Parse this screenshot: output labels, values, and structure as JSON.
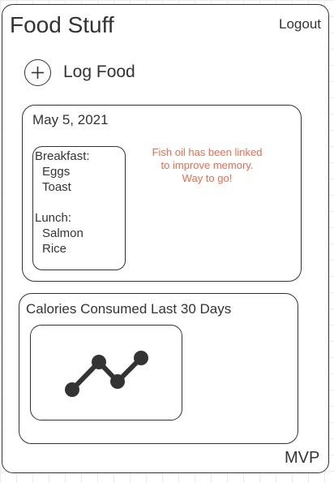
{
  "header": {
    "app_title": "Food Stuff",
    "logout_label": "Logout"
  },
  "actions": {
    "log_food_label": "Log Food",
    "log_food_icon": "plus-icon"
  },
  "day_card": {
    "date": "May 5, 2021",
    "meals": [
      {
        "name": "Breakfast:",
        "items": [
          "Eggs",
          "Toast"
        ]
      },
      {
        "name": "Lunch:",
        "items": [
          "Salmon",
          "Rice"
        ]
      }
    ],
    "tip_lines": [
      "Fish oil has been linked",
      "to improve memory.",
      "Way to go!"
    ],
    "tip_color": "#f26a4b"
  },
  "calories_card": {
    "title": "Calories Consumed Last 30 Days",
    "chart_icon": "line-chart-icon"
  },
  "footer": {
    "version_label": "MVP"
  }
}
